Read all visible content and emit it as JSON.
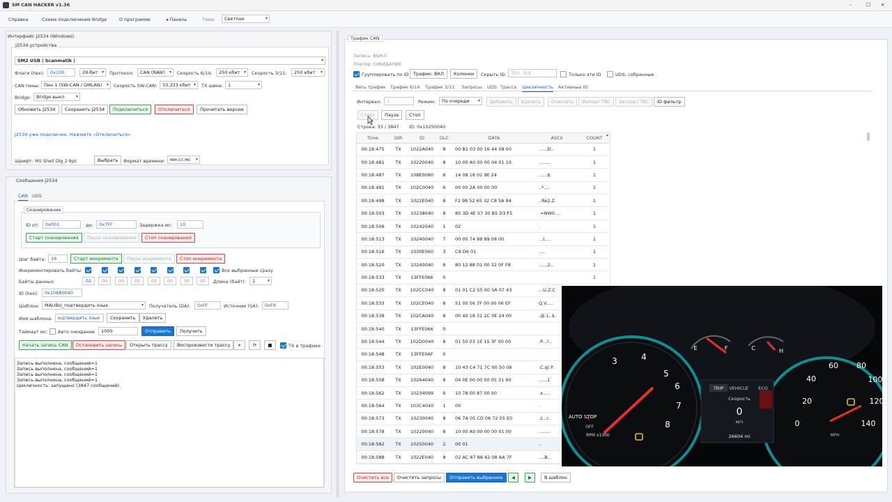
{
  "app": {
    "title": "SM CAN HACKER v1.36",
    "win_min": "–",
    "win_max": "□",
    "win_close": "✕"
  },
  "menu": {
    "help": "Справка",
    "bridge": "Схема подключения Bridge",
    "about": "О программе",
    "panel": "◂ Панель",
    "theme_label": "Тема:",
    "theme_value": "Светлая"
  },
  "left": {
    "interface_title": "Интерфейс J2534 (Windows).",
    "devices_title": "J2534 устройства",
    "device_value": "SM2 USB | Scanmatik |",
    "flags_label": "Флаги (hex):",
    "flags_value": "0x100",
    "bits_value": "29-бит",
    "protocol_label": "Протокол:",
    "protocol_value": "CAN (RAW)",
    "speed614_label": "Скорость 6/14:",
    "speed614_value": "250 кбит",
    "speed311_label": "Скорость 3/11:",
    "speed311_value": "250 кбит",
    "canpins_label": "CAN пины:",
    "canpins_value": "Пин 1 (SW-CAN / GMLAN)",
    "swcan_label": "Скорость SW-CAN:",
    "swcan_value": "33.333 кбит",
    "txbus_label": "TX шина:",
    "txbus_value": "1",
    "bridge_label": "Bridge:",
    "bridge_value": "Bridge выкл",
    "btn_update": "Обновить J2534",
    "btn_save": "Сохранить J2534",
    "btn_connect": "Подключиться",
    "btn_disconnect": "Отключиться",
    "btn_read": "Прочитать версии",
    "status": "J2534 уже подключен. Нажмите «Отключиться».",
    "font_label": "Шрифт:",
    "font_value": "MS Shell Dlg 2 8pt",
    "btn_choose": "Выбрать",
    "timefmt_label": "Формат времени:",
    "timefmt_value": "мм:сс:мс"
  },
  "messages": {
    "title": "Сообщения J2534",
    "tab_can": "CAN",
    "tab_uds": "UDS",
    "scan_title": "Сканирование",
    "id_from_label": "ID от:",
    "id_from": "0x001",
    "id_to_label": "до:",
    "id_to": "0x7FF",
    "delay_label": "Задержка мс:",
    "delay": "10",
    "btn_scan_start": "Старт сканирования",
    "btn_scan_pause": "Пауза сканирования",
    "btn_scan_stop": "Стоп сканирования",
    "step_label": "Шаг байта:",
    "step": "16",
    "btn_inc_start": "Старт инкремента",
    "btn_inc_pause": "Пауза инкремента",
    "btn_inc_stop": "Стоп инкремента",
    "inc_bytes_label": "Инкрементировать байты:",
    "all_selected": "Все выбранные сразу",
    "data_bytes_label": "Байты данных:",
    "data_bytes": [
      "02",
      "00",
      "00",
      "00",
      "00",
      "00",
      "00",
      "00"
    ],
    "length_label": "Длина (байт):",
    "length": "1",
    "id_hex_label": "ID (hex):",
    "id_hex": "0x10680040",
    "template_label": "Шаблон:",
    "template": "MALIBU_подтвердить язык",
    "receiver_label": "Получатель (DA):",
    "receiver": "0xFF",
    "source_label": "Источник (SA):",
    "source": "0xF9",
    "tname_label": "Имя шаблона:",
    "tname": "юдтвердить язык",
    "btn_tsave": "Сохранить",
    "btn_tdelete": "Удалить",
    "timeout_label": "Таймаут мс:",
    "auto_wait": "Авто ожидание",
    "timeout": "1000",
    "btn_send": "Отправить",
    "btn_receive": "Получить",
    "btn_rec_start": "Начать запись CAN",
    "btn_rec_stop": "Остановить запись",
    "btn_open_trace": "Открыть трассу",
    "btn_play_trace": "Воспроизвести трассу",
    "btn_pause_icon": "⏸",
    "btn_loop_icon": "⟳",
    "btn_stop_icon": "■",
    "tx_in_traffic": "TX в трафике",
    "log": [
      "Запись выполнена, сообщений=1",
      "Запись выполнена, сообщений=1",
      "Запись выполнена, сообщений=1",
      "Запись выполнена, сообщений=1",
      "Цикличность: запущено (3847 сообщений)."
    ]
  },
  "traffic": {
    "title": "Трафик CAN",
    "rec_status": "Запись: ВЫКЛ",
    "repeat_status": "Повтор: ОЖИДАНИЕ",
    "group_by_id": "Группировать по ID",
    "btn_traffic": "Трафик: ВКЛ",
    "btn_columns": "Колонки",
    "hide_label": "Скрыть ID:",
    "hide_placeholder": "7E0, 7E8",
    "only_these": "Только эти ID",
    "uds_collected": "UDS: собранные",
    "tabs": [
      "Весь трафик",
      "Трафик 6/14",
      "Трафик 3/11",
      "Запросы",
      "UDS",
      "Трасса",
      "Цикличность",
      "Активные ID"
    ],
    "interval_label": "Интервал:",
    "interval_value": "1",
    "mode_label": "Режим:",
    "mode_value": "По очереди",
    "btn_add": "Добавить",
    "btn_delete": "Удалить",
    "btn_clear": "Очистить",
    "btn_import": "Импорт TRC",
    "btn_export": "Экспорт TRC",
    "btn_idfilter": "ID фильтр",
    "btn_start": "Старт",
    "btn_pause": "Пауза",
    "btn_stop": "Стоп",
    "row_info": "Строка: 33 / 3847",
    "id_info": "ID: 0x10250040",
    "columns": [
      "Time",
      "DIR",
      "ID",
      "DLC",
      "DATA",
      "ASCII",
      "COUNT"
    ],
    "rows": [
      [
        "00:18:475",
        "TX",
        "1022A040",
        "8",
        "00 B1 03 00 16 44 08 00",
        "......D..",
        "1"
      ],
      [
        "00:18:481",
        "TX",
        "10220040",
        "8",
        "10 00 A0 00 00 04 01 10",
        "........",
        "1"
      ],
      [
        "00:18:487",
        "TX",
        "108E0080",
        "6",
        "14 08 18 02 9E 24",
        "......$",
        "1"
      ],
      [
        "00:18:491",
        "TX",
        "102C0040",
        "6",
        "00 00 2A 00 00 00",
        "..*....",
        "1"
      ],
      [
        "00:18:498",
        "TX",
        "1022E040",
        "8",
        "F2 98 52 65 32 C8 5A 84",
        "..Re2.Z.",
        "1"
      ],
      [
        "00:18:503",
        "TX",
        "10238040",
        "8",
        "80 3D 4E 57 30 B5 D3 F5",
        ".=NW0....",
        "1"
      ],
      [
        "00:18:506",
        "TX",
        "10242040",
        "1",
        "02",
        ".",
        "1"
      ],
      [
        "00:18:513",
        "TX",
        "10240040",
        "7",
        "00 00 74 88 89 08 00",
        "...t....",
        "1"
      ],
      [
        "00:18:516",
        "TX",
        "1030E060",
        "3",
        "C9 D6 01",
        "....",
        "1"
      ],
      [
        "00:18:520",
        "TX",
        "10240040",
        "8",
        "80 12 88 01 00 32 0F F8",
        "......2..",
        "1"
      ],
      [
        "00:18:533",
        "TX",
        "13FFE066",
        "0",
        "",
        "",
        "1"
      ],
      [
        "00:18:520",
        "TX",
        "102CC040",
        "8",
        "01 01 C2 55 00 5A 07 43",
        "...U.Z.C",
        "1"
      ],
      [
        "00:18:533",
        "TX",
        "102CE040",
        "8",
        "51 00 56 7F 00 00 06 EF",
        "Q.V.....",
        "1"
      ],
      [
        "00:18:538",
        "TX",
        "102CA040",
        "8",
        "00 40 18 31 2C 0E 24 00",
        ".@.1,.$.",
        "1"
      ],
      [
        "00:18:540",
        "TX",
        "13FFE066",
        "0",
        "",
        "",
        "1"
      ],
      [
        "00:18:544",
        "TX",
        "102D0040",
        "8",
        "01 50 03 1E 15 3F 00 00",
        ".P...?..",
        "1"
      ],
      [
        "00:18:548",
        "TX",
        "13FFE0AF",
        "0",
        "",
        "",
        "1"
      ],
      [
        "00:18:553",
        "TX",
        "102E0040",
        "8",
        "10 43 C4 71 7C 00 50 08",
        ".C.q|.P.",
        "1"
      ],
      [
        "00:18:558",
        "TX",
        "10264040",
        "8",
        "04 0E 00 00 00 05 31 60",
        "......1`",
        "1"
      ],
      [
        "00:18:562",
        "TX",
        "10234099",
        "6",
        "10 78 00 87 00 00",
        ".x.....",
        "1"
      ],
      [
        "00:18:564",
        "TX",
        "103C4040",
        "1",
        "00",
        ".",
        "1"
      ],
      [
        "00:18:573",
        "TX",
        "10230040",
        "8",
        "06 7A 05 CD 06 72 05 E0",
        ".z...r..",
        "1"
      ],
      [
        "00:18:578",
        "TX",
        "10220040",
        "8",
        "10 00 A0 00 00 00 01 00",
        "........",
        "1"
      ],
      [
        "00:18:582",
        "TX",
        "10250040",
        "2",
        "00 01",
        "..",
        "1"
      ],
      [
        "00:18:588",
        "TX",
        "1022E040",
        "8",
        "02 AC 87 88 42 08 AA 7F",
        "....B...",
        "1"
      ]
    ],
    "btn_clear_all": "Очистить все",
    "btn_clear_requests": "Очистить запросы",
    "btn_send_selected": "Отправить выбранное",
    "btn_prev_icon": "◀",
    "btn_next_icon": "▶",
    "btn_to_template": "В шаблон"
  },
  "dash": {
    "auto_stop": "AUTO STOP",
    "rpm_label": "RPM x1000",
    "off_label": "OFF",
    "tach_ticks": [
      "3",
      "4",
      "5",
      "6",
      "7",
      "8"
    ],
    "speedo_ticks": [
      "20",
      "40",
      "60",
      "80",
      "100",
      "120",
      "140"
    ],
    "speedo_unit": "MPH",
    "trip": "TRIP",
    "vehicle": "VEHICLE",
    "eco": "ECO",
    "speed_label": "Скорость",
    "speed_value": "0",
    "speed_unit": "м/ч",
    "odometer": "26604 mi",
    "e_label": "E",
    "f_label": "F",
    "c_label": "C",
    "h_label": "H"
  }
}
